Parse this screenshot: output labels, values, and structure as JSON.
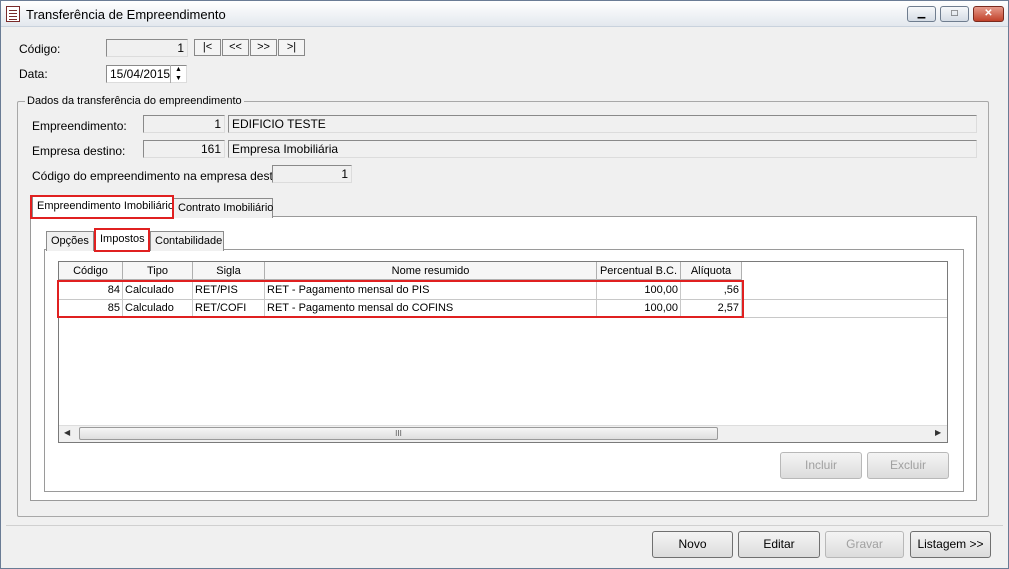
{
  "window": {
    "title": "Transferência de Empreendimento",
    "minimize": "▁",
    "maximize": "□",
    "close": "✕"
  },
  "codigo": {
    "label": "Código:",
    "value": "1"
  },
  "nav": {
    "first": "|<",
    "prev": "<<",
    "next": ">>",
    "last": ">|"
  },
  "data": {
    "label": "Data:",
    "value": "15/04/2015",
    "up": "▲",
    "down": "▼"
  },
  "group": {
    "title": "Dados da transferência do empreendimento",
    "empreendimento": {
      "label": "Empreendimento:",
      "code": "1",
      "name": "EDIFICIO TESTE"
    },
    "empresa_destino": {
      "label": "Empresa destino:",
      "code": "161",
      "name": "Empresa Imobiliária"
    },
    "codigo_destino": {
      "label": "Código do empreendimento na empresa destino:",
      "value": "1"
    }
  },
  "outer_tabs": [
    "Empreendimento Imobiliário",
    "Contrato Imobiliário"
  ],
  "inner_tabs": [
    "Opções",
    "Impostos",
    "Contabilidade"
  ],
  "table": {
    "headers": [
      "Código",
      "Tipo",
      "Sigla",
      "Nome resumido",
      "Percentual B.C.",
      "Alíquota"
    ],
    "rows": [
      [
        "84",
        "Calculado",
        "RET/PIS",
        "RET - Pagamento mensal do PIS",
        "100,00",
        ",56"
      ],
      [
        "85",
        "Calculado",
        "RET/COFI",
        "RET - Pagamento mensal do COFINS",
        "100,00",
        "2,57"
      ]
    ],
    "scroll_left": "◀",
    "scroll_right": "▶",
    "thumb_grip": "III"
  },
  "grid_buttons": {
    "incluir": "Incluir",
    "excluir": "Excluir"
  },
  "footer": {
    "novo": "Novo",
    "editar": "Editar",
    "gravar": "Gravar",
    "listagem": "Listagem >>"
  }
}
